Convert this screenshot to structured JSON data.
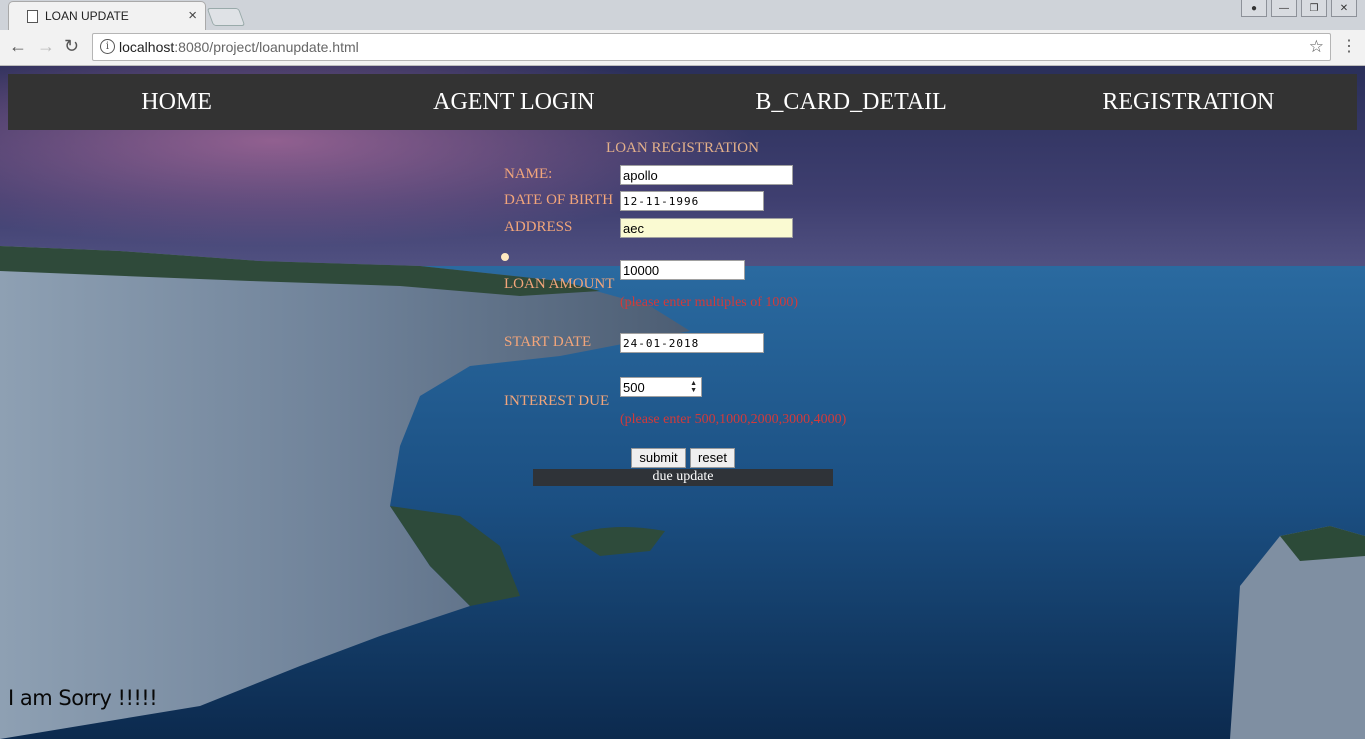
{
  "browser": {
    "tab_title": "LOAN UPDATE",
    "tab_close": "×",
    "window_controls": [
      "user-icon",
      "minimize-icon",
      "restore-icon",
      "close-icon"
    ],
    "url_host": "localhost",
    "url_rest": ":8080/project/loanupdate.html",
    "back_icon": "←",
    "forward_icon": "→",
    "reload_icon": "↻",
    "star_icon": "☆",
    "menu_icon": "⋮"
  },
  "nav": {
    "items": [
      "HOME",
      "AGENT LOGIN",
      "B_CARD_DETAIL",
      "REGISTRATION"
    ]
  },
  "form": {
    "title": "LOAN REGISTRATION",
    "name_label": "NAME:",
    "name_value": "apollo",
    "dob_label": "DATE OF BIRTH",
    "dob_value": "12-11-1996",
    "address_label": "ADDRESS",
    "address_value": "aec",
    "loan_label": "LOAN AMOUNT",
    "loan_value": "10000",
    "loan_hint": "(please enter multiples of 1000)",
    "start_label": "START DATE",
    "start_value": "24-01-2018",
    "interest_label": "INTEREST DUE",
    "interest_value": "500",
    "interest_hint": "(please enter 500,1000,2000,3000,4000)",
    "submit_label": "submit",
    "reset_label": "reset",
    "due_update": "due update"
  },
  "footer": {
    "sorry_text": "I am Sorry !!!!!"
  }
}
